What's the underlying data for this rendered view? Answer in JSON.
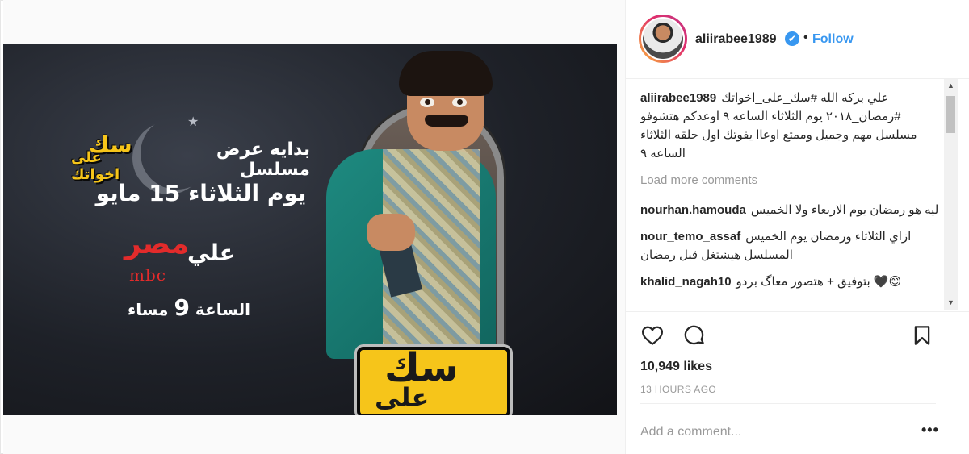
{
  "post": {
    "username": "aliirabee1989",
    "verified_badge": "✔",
    "separator": "•",
    "follow_label": "Follow",
    "likes": "10,949 likes",
    "time_ago": "13 HOURS AGO",
    "add_comment_placeholder": "Add a comment...",
    "more_options": "•••"
  },
  "image": {
    "promo_start": "بدايه عرض مسلسل",
    "promo_date": "يوم الثلاثاء 15 مايو",
    "promo_ali": "علي",
    "channel_arabic": "مصر",
    "channel_latin": "mbc",
    "promo_time_label": "الساعة",
    "promo_time_number": "9",
    "promo_time_suffix": "مساء",
    "show_logo_top": "سك",
    "show_logo_bottom": "على اخواتك"
  },
  "caption": {
    "username": "aliirabee1989",
    "text": "علي بركه الله #سك_على_اخواتك #رمضان_٢٠١٨ يوم الثلاثاء الساعه ٩ اوعدكم هتشوفو مسلسل مهم وجميل وممتع اوعاا يفوتك اول حلقه الثلاثاء الساعه ٩"
  },
  "load_more_label": "Load more comments",
  "comments": [
    {
      "username": "nourhan.hamouda",
      "text": "ليه هو رمضان يوم الاربعاء ولا الخميس"
    },
    {
      "username": "nour_temo_assaf",
      "text": "ازاي الثلاثاء ورمضان يوم الخميس المسلسل هيشتغل قبل رمضان"
    },
    {
      "username": "khalid_nagah10",
      "text": "بتوفيق + هتصور معاگ بردو 🖤😊"
    }
  ],
  "icons": {
    "heart": "heart-icon",
    "comment": "comment-icon",
    "bookmark": "bookmark-icon"
  },
  "colors": {
    "accent": "#3897f0",
    "text": "#262626",
    "muted": "#999999",
    "logo_yellow": "#f6c51a",
    "channel_red": "#e32b2b"
  }
}
